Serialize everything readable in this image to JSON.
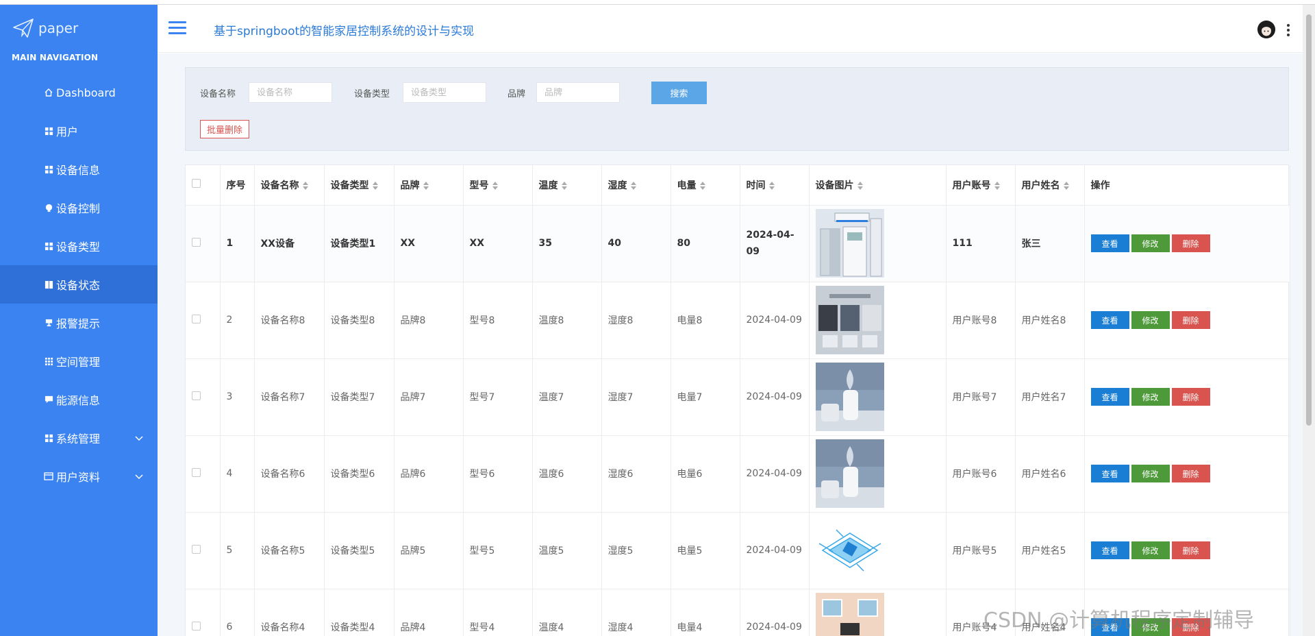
{
  "brand": {
    "name": "paper"
  },
  "sidebar": {
    "heading": "MAIN NAVIGATION",
    "items": [
      {
        "label": "Dashboard",
        "icon": "home-icon",
        "active": false,
        "expandable": false
      },
      {
        "label": "用户",
        "icon": "grid-icon",
        "active": false,
        "expandable": false
      },
      {
        "label": "设备信息",
        "icon": "grid-icon",
        "active": false,
        "expandable": false
      },
      {
        "label": "设备控制",
        "icon": "bulb-icon",
        "active": false,
        "expandable": false
      },
      {
        "label": "设备类型",
        "icon": "grid-icon",
        "active": false,
        "expandable": false
      },
      {
        "label": "设备状态",
        "icon": "book-icon",
        "active": true,
        "expandable": false
      },
      {
        "label": "报警提示",
        "icon": "trophy-icon",
        "active": false,
        "expandable": false
      },
      {
        "label": "空间管理",
        "icon": "grid3-icon",
        "active": false,
        "expandable": false
      },
      {
        "label": "能源信息",
        "icon": "comment-icon",
        "active": false,
        "expandable": false
      },
      {
        "label": "系统管理",
        "icon": "grid-icon",
        "active": false,
        "expandable": true
      },
      {
        "label": "用户资料",
        "icon": "card-icon",
        "active": false,
        "expandable": true
      }
    ]
  },
  "header": {
    "title": "基于springboot的智能家居控制系统的设计与实现"
  },
  "search": {
    "fields": [
      {
        "label": "设备名称",
        "placeholder": "设备名称",
        "value": ""
      },
      {
        "label": "设备类型",
        "placeholder": "设备类型",
        "value": ""
      },
      {
        "label": "品牌",
        "placeholder": "品牌",
        "value": ""
      }
    ],
    "search_label": "搜索",
    "batch_delete_label": "批量删除"
  },
  "table": {
    "columns": [
      "序号",
      "设备名称",
      "设备类型",
      "品牌",
      "型号",
      "温度",
      "湿度",
      "电量",
      "时间",
      "设备图片",
      "用户账号",
      "用户姓名",
      "操作"
    ],
    "actions": {
      "view": "查看",
      "edit": "修改",
      "delete": "删除"
    },
    "rows": [
      {
        "no": "1",
        "name": "XX设备",
        "type": "设备类型1",
        "brand": "XX",
        "model": "XX",
        "temp": "35",
        "humidity": "40",
        "power": "80",
        "time": "2024-04-09",
        "image": "air-conditioner-image",
        "account": "111",
        "user": "张三"
      },
      {
        "no": "2",
        "name": "设备名称8",
        "type": "设备类型8",
        "brand": "品牌8",
        "model": "型号8",
        "temp": "温度8",
        "humidity": "湿度8",
        "power": "电量8",
        "time": "2024-04-09",
        "image": "smart-device-collage-image",
        "account": "用户账号8",
        "user": "用户姓名8"
      },
      {
        "no": "3",
        "name": "设备名称7",
        "type": "设备类型7",
        "brand": "品牌7",
        "model": "型号7",
        "temp": "温度7",
        "humidity": "湿度7",
        "power": "电量7",
        "time": "2024-04-09",
        "image": "humidifier-image",
        "account": "用户账号7",
        "user": "用户姓名7"
      },
      {
        "no": "4",
        "name": "设备名称6",
        "type": "设备类型6",
        "brand": "品牌6",
        "model": "型号6",
        "temp": "温度6",
        "humidity": "湿度6",
        "power": "电量6",
        "time": "2024-04-09",
        "image": "humidifier-image",
        "account": "用户账号6",
        "user": "用户姓名6"
      },
      {
        "no": "5",
        "name": "设备名称5",
        "type": "设备类型5",
        "brand": "品牌5",
        "model": "型号5",
        "temp": "温度5",
        "humidity": "湿度5",
        "power": "电量5",
        "time": "2024-04-09",
        "image": "chip-image",
        "account": "用户账号5",
        "user": "用户姓名5"
      },
      {
        "no": "6",
        "name": "设备名称4",
        "type": "设备类型4",
        "brand": "品牌4",
        "model": "型号4",
        "temp": "温度4",
        "humidity": "湿度4",
        "power": "电量4",
        "time": "2024-04-09",
        "image": "smart-home-room-image",
        "account": "用户账号4",
        "user": "用户姓名4"
      }
    ]
  },
  "watermark": "CSDN @计算机程序定制辅导",
  "colors": {
    "sidebar": "#3a83f0",
    "sidebar_active": "#2f6fd8",
    "accent": "#2a7ad6",
    "view": "#1a7fd4",
    "edit": "#4e9a3a",
    "delete": "#d9534f"
  }
}
